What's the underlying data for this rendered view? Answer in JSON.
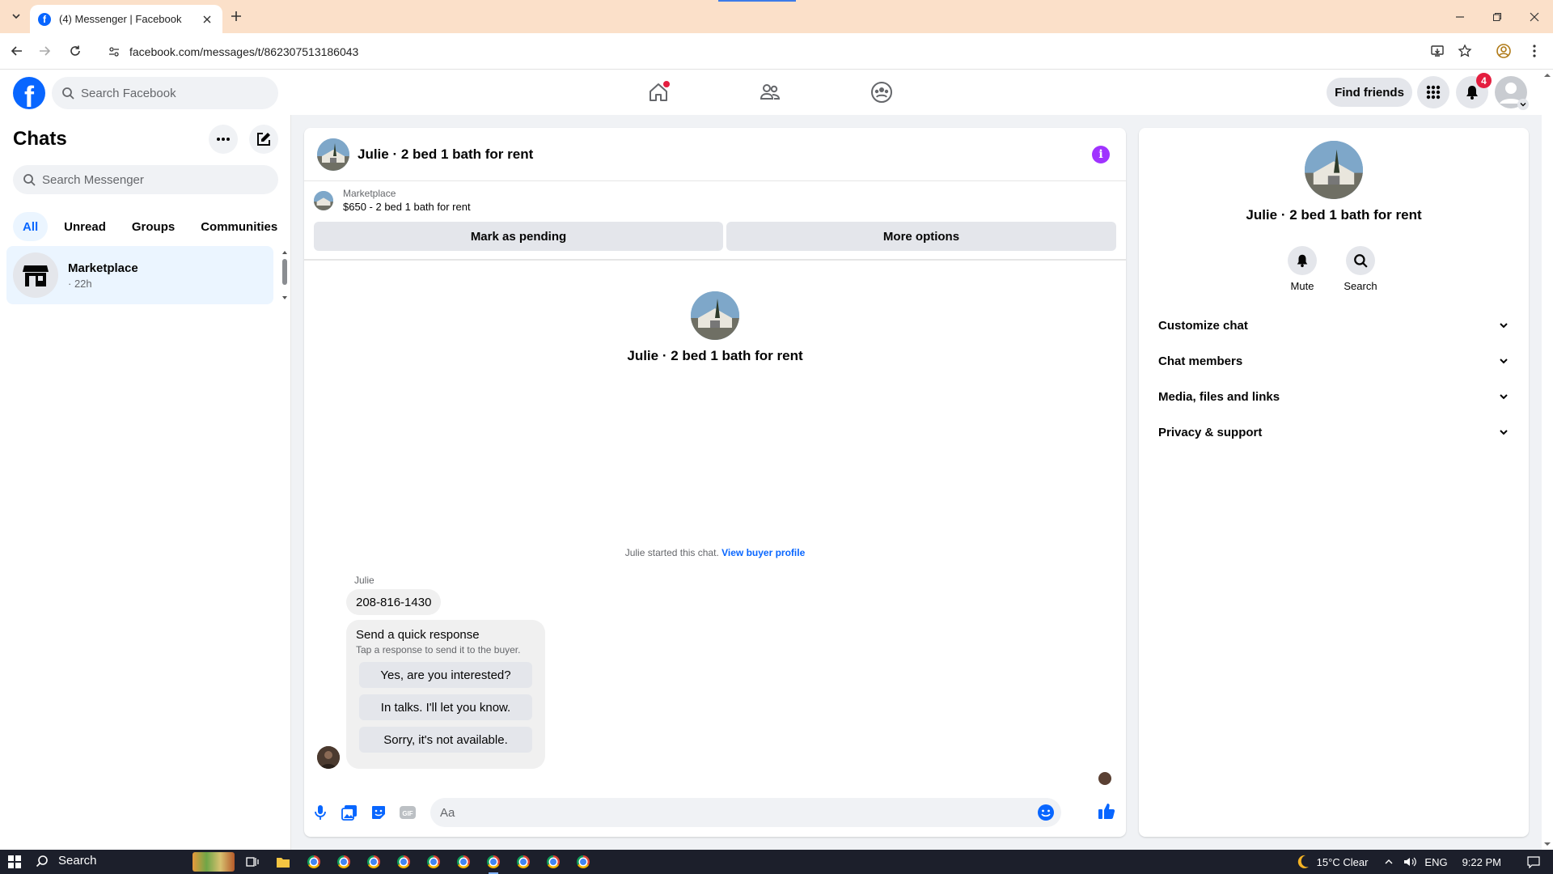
{
  "browser": {
    "tab_title": "(4) Messenger | Facebook",
    "url": "facebook.com/messages/t/862307513186043"
  },
  "fb": {
    "search_placeholder": "Search Facebook",
    "find_friends": "Find friends",
    "notif_count": "4",
    "home_has_dot": true
  },
  "chats": {
    "title": "Chats",
    "search_placeholder": "Search Messenger",
    "filters": [
      "All",
      "Unread",
      "Groups",
      "Communities"
    ],
    "active_filter": "All",
    "items": [
      {
        "name": "Marketplace",
        "time": "· 22h",
        "icon": "marketplace-store-icon"
      }
    ]
  },
  "conversation": {
    "title": "Julie · 2 bed 1 bath for rent",
    "marketplace_label": "Marketplace",
    "listing": "$650 - 2 bed 1 bath for rent",
    "mark_pending": "Mark as pending",
    "more_options": "More options",
    "profile_name": "Julie · 2 bed 1 bath for rent",
    "started_text": "Julie started this chat.",
    "view_buyer_profile": "View buyer profile",
    "sender": "Julie",
    "phone_message": "208-816-1430",
    "quick_title": "Send a quick response",
    "quick_subtitle": "Tap a response to send it to the buyer.",
    "quick_responses": [
      "Yes, are you interested?",
      "In talks. I'll let you know.",
      "Sorry, it's not available."
    ],
    "composer_placeholder": "Aa"
  },
  "info": {
    "name": "Julie · 2 bed 1 bath for rent",
    "mute": "Mute",
    "search": "Search",
    "sections": [
      "Customize chat",
      "Chat members",
      "Media, files and links",
      "Privacy & support"
    ]
  },
  "taskbar": {
    "search": "Search",
    "weather": "15°C  Clear",
    "lang": "ENG",
    "time": "9:22 PM"
  },
  "colors": {
    "fb_blue": "#0866ff",
    "info_purple": "#a033ff",
    "badge_red": "#e41e3f",
    "tabstrip": "#fbe0c9"
  }
}
